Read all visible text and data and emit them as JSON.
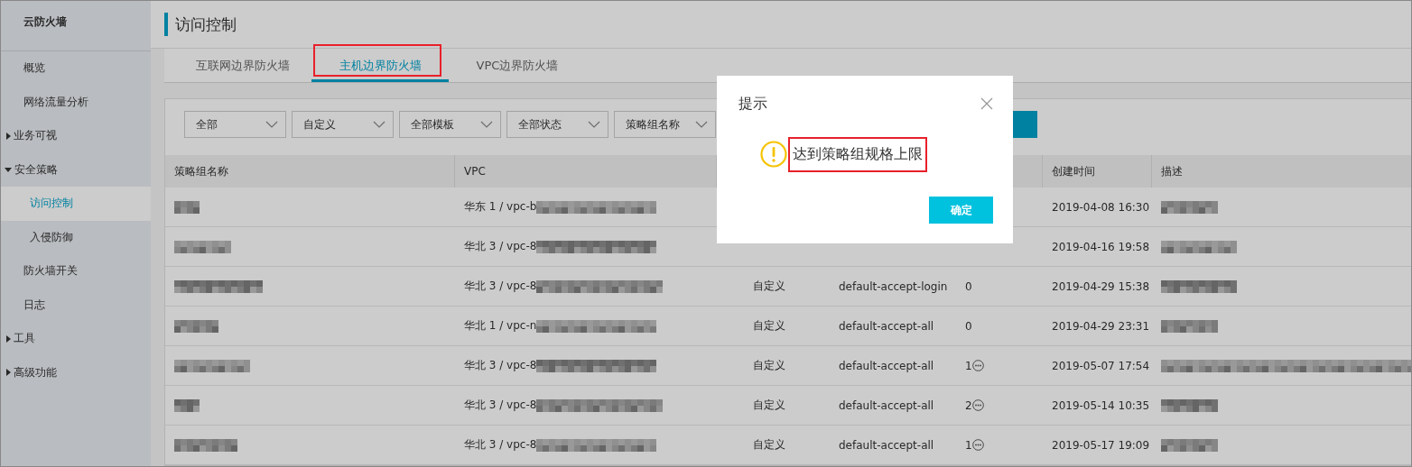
{
  "sidebar": {
    "title": "云防火墙",
    "items": [
      {
        "label": "概览",
        "selected": false
      },
      {
        "label": "网络流量分析",
        "selected": false
      },
      {
        "label": "业务可视",
        "selected": false,
        "expanded": false
      },
      {
        "label": "安全策略",
        "selected": false,
        "expanded": true,
        "children": [
          {
            "label": "访问控制",
            "selected": true
          },
          {
            "label": "入侵防御",
            "selected": false
          }
        ]
      },
      {
        "label": "防火墙开关",
        "selected": false
      },
      {
        "label": "日志",
        "selected": false
      },
      {
        "label": "工具",
        "selected": false,
        "expanded": false
      },
      {
        "label": "高级功能",
        "selected": false,
        "expanded": false
      }
    ]
  },
  "page_title": "访问控制",
  "tabs": [
    {
      "label": "互联网边界防火墙",
      "selected": false,
      "highlighted": false
    },
    {
      "label": "主机边界防火墙",
      "selected": true,
      "highlighted": true
    },
    {
      "label": "VPC边界防火墙",
      "selected": false,
      "highlighted": false
    }
  ],
  "filters": [
    "全部",
    "自定义",
    "全部模板",
    "全部状态",
    "策略组名称"
  ],
  "table": {
    "columns": [
      "策略组名称",
      "VPC",
      null,
      null,
      null,
      "创建时间",
      "描述"
    ],
    "rows": [
      {
        "name_redacted": true,
        "vpc": "华东 1 / vpc-b",
        "created": "2019-04-08 16:30",
        "desc_redacted": true
      },
      {
        "name_redacted": true,
        "vpc": "华北 3 / vpc-8",
        "created": "2019-04-16 19:58",
        "desc_redacted": true
      },
      {
        "name_redacted": true,
        "vpc": "华北 3 / vpc-8",
        "type": "自定义",
        "template": "default-accept-login",
        "count": "0",
        "more": false,
        "created": "2019-04-29 15:38",
        "desc_redacted": true
      },
      {
        "name_redacted": true,
        "vpc": "华北 1 / vpc-n",
        "type": "自定义",
        "template": "default-accept-all",
        "count": "0",
        "more": false,
        "created": "2019-04-29 23:31",
        "desc_redacted": true
      },
      {
        "name_redacted": true,
        "vpc": "华北 3 / vpc-8",
        "type": "自定义",
        "template": "default-accept-all",
        "count": "1",
        "more": true,
        "created": "2019-05-07 17:54",
        "desc_redacted": true
      },
      {
        "name_redacted": true,
        "vpc": "华北 3 / vpc-8",
        "type": "自定义",
        "template": "default-accept-all",
        "count": "2",
        "more": true,
        "created": "2019-05-14 10:35",
        "desc_redacted": true
      },
      {
        "name_redacted": true,
        "vpc": "华北 3 / vpc-8",
        "type": "自定义",
        "template": "default-accept-all",
        "count": "1",
        "more": true,
        "created": "2019-05-17 19:09",
        "desc_redacted": true
      }
    ]
  },
  "dialog": {
    "title": "提示",
    "message": "达到策略组规格上限",
    "message_highlighted": true,
    "confirm": "确定"
  }
}
